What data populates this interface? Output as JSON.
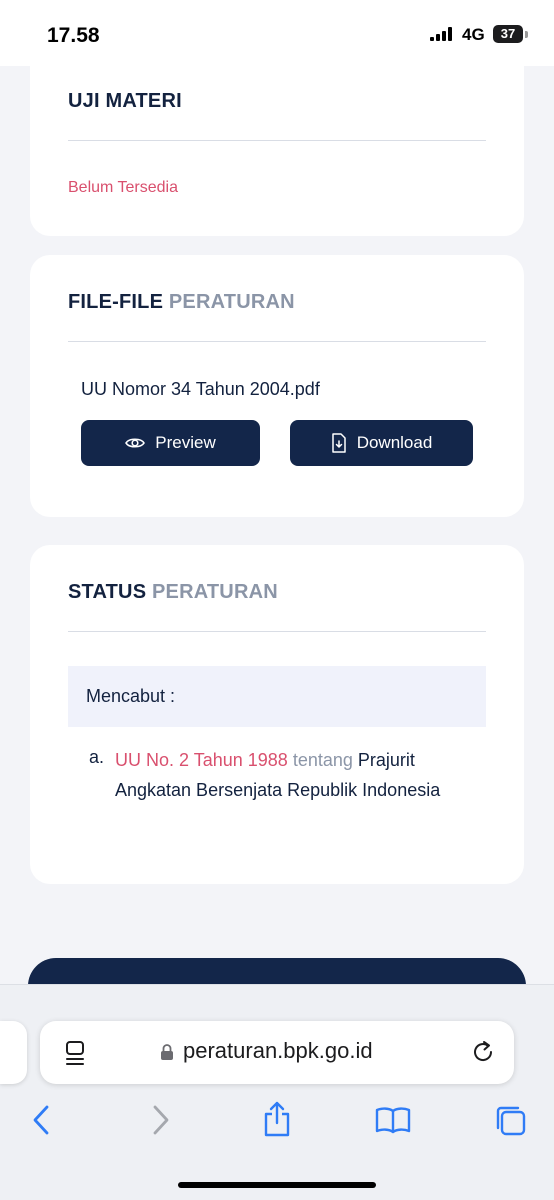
{
  "status_bar": {
    "time": "17.58",
    "network": "4G",
    "battery": "37"
  },
  "uji_materi": {
    "title": "UJI MATERI",
    "value": "Belum Tersedia"
  },
  "file_section": {
    "title_dark": "FILE-FILE",
    "title_grey": "PERATURAN",
    "file_name": "UU Nomor 34 Tahun 2004.pdf",
    "preview_label": "Preview",
    "download_label": "Download"
  },
  "status_section": {
    "title_dark": "STATUS",
    "title_grey": "PERATURAN",
    "mencabut_label": "Mencabut :",
    "items": [
      {
        "marker": "a.",
        "link": "UU No. 2 Tahun 1988",
        "connector": "tentang",
        "text": "Prajurit Angkatan Bersenjata Republik Indonesia"
      }
    ]
  },
  "browser": {
    "url": "peraturan.bpk.go.id"
  },
  "colors": {
    "navy": "#13264a",
    "pink": "#d9506e",
    "grey": "#8b95a7",
    "ios_blue": "#2f7cf6"
  },
  "icons": {
    "preview": "eye-icon",
    "download": "file-download-icon",
    "reader": "reader-mode-icon",
    "lock": "lock-icon",
    "reload": "reload-icon",
    "back": "chevron-left-icon",
    "forward": "chevron-right-icon",
    "share": "share-icon",
    "bookmarks": "book-icon",
    "tabs": "tabs-icon"
  }
}
